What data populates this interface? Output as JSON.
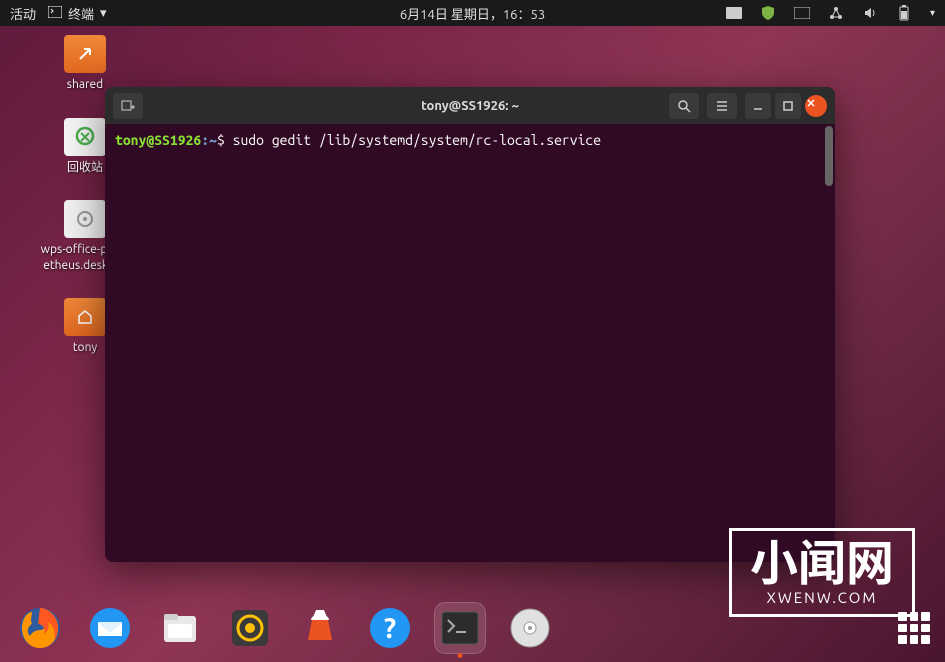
{
  "topbar": {
    "activities": "活动",
    "appname": "终端",
    "datetime": "6月14日 星期日，16：53"
  },
  "desktop": {
    "icons": [
      {
        "label": "shared",
        "type": "folder-link"
      },
      {
        "label": "回收站",
        "type": "trash"
      },
      {
        "label": "wps-office-prometheus.desktop",
        "type": "file"
      },
      {
        "label": "tony",
        "type": "folder-home"
      }
    ]
  },
  "terminal": {
    "title": "tony@SS1926: ~",
    "prompt_user": "tony@SS1926",
    "prompt_sep": ":",
    "prompt_path": "~",
    "prompt_symbol": "$",
    "command": "sudo gedit /lib/systemd/system/rc-local.service"
  },
  "dock": {
    "items": [
      {
        "name": "firefox"
      },
      {
        "name": "thunderbird"
      },
      {
        "name": "files"
      },
      {
        "name": "rhythmbox"
      },
      {
        "name": "software"
      },
      {
        "name": "help"
      },
      {
        "name": "terminal",
        "active": true
      },
      {
        "name": "disc"
      }
    ]
  },
  "watermark": {
    "main": "小闻网",
    "sub": "XWENW.COM"
  }
}
